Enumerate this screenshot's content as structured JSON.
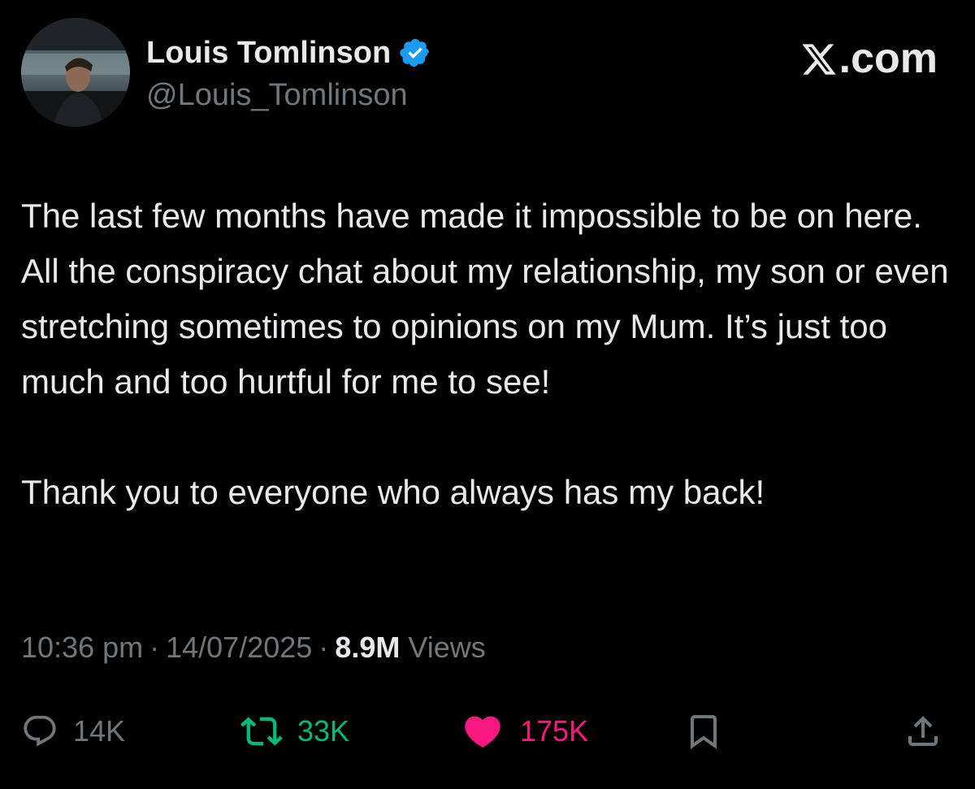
{
  "author": {
    "display_name": "Louis Tomlinson",
    "handle": "@Louis_Tomlinson",
    "verified": true,
    "verified_color": "#1d9bf0"
  },
  "brand": {
    "label": ".com",
    "logo_icon": "x-logo-icon"
  },
  "tweet": {
    "paragraph_1": "The last few months have made it impossible to be on here. All the conspiracy chat about my relationship, my son or even stretching sometimes to opinions on my Mum. It’s just too much and too hurtful for me to see!",
    "paragraph_2": "Thank you to everyone who always has my back!"
  },
  "meta": {
    "time": "10:36 pm",
    "date": "14/07/2025",
    "views_count": "8.9M",
    "views_label": "Views",
    "separator": "·"
  },
  "actions": {
    "reply": {
      "icon": "reply-icon",
      "count": "14K"
    },
    "retweet": {
      "icon": "retweet-icon",
      "count": "33K",
      "color": "#00ba7c"
    },
    "like": {
      "icon": "heart-icon",
      "count": "175K",
      "color": "#f91880"
    },
    "bookmark": {
      "icon": "bookmark-icon"
    },
    "share": {
      "icon": "share-icon"
    }
  },
  "colors": {
    "background": "#000000",
    "primary_text": "#e7e9ea",
    "secondary_text": "#71767b"
  }
}
